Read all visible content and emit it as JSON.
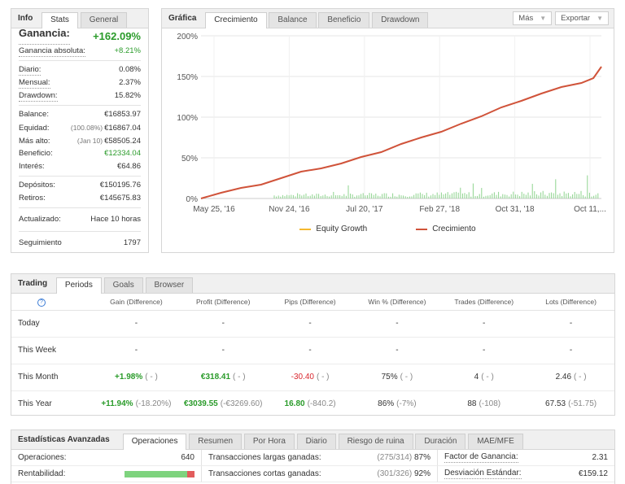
{
  "info": {
    "tabs": [
      "Info",
      "Stats",
      "General"
    ],
    "gain_label": "Ganancia:",
    "gain_value": "+162.09%",
    "abs_gain_label": "Ganancia absoluta:",
    "abs_gain_value": "+8.21%",
    "daily_label": "Diario:",
    "daily_value": "0.08%",
    "monthly_label": "Mensual:",
    "monthly_value": "2.37%",
    "drawdown_label": "Drawdown:",
    "drawdown_value": "15.82%",
    "balance_label": "Balance:",
    "balance_value": "€16853.97",
    "equity_label": "Equidad:",
    "equity_note": "(100.08%)",
    "equity_value": "€16867.04",
    "highest_label": "Más alto:",
    "highest_note": "(Jan 10)",
    "highest_value": "€58505.24",
    "profit_label": "Beneficio:",
    "profit_value": "€12334.04",
    "interest_label": "Interés:",
    "interest_value": "€64.86",
    "deposits_label": "Depósitos:",
    "deposits_value": "€150195.76",
    "withdrawals_label": "Retiros:",
    "withdrawals_value": "€145675.83",
    "updated_label": "Actualizado:",
    "updated_value": "Hace 10 horas",
    "following_label": "Seguimiento",
    "following_value": "1797"
  },
  "chart_panel": {
    "title": "Gráfica",
    "tabs": [
      "Crecimiento",
      "Balance",
      "Beneficio",
      "Drawdown"
    ],
    "more_label": "Más",
    "export_label": "Exportar",
    "legend": [
      "Equity Growth",
      "Crecimiento"
    ]
  },
  "chart_data": {
    "type": "line",
    "y_ticks": [
      "200%",
      "150%",
      "100%",
      "50%",
      "0%"
    ],
    "ylim": [
      0,
      200
    ],
    "x_ticks": [
      "May 25, '16",
      "Nov 24, '16",
      "Jul 20, '17",
      "Feb 27, '18",
      "Oct 31, '18",
      "Oct 11,..."
    ],
    "grid": true,
    "legend_position": "bottom",
    "series": [
      {
        "name": "Crecimiento",
        "color": "#d0533a",
        "x_frac": [
          0,
          0.05,
          0.1,
          0.15,
          0.2,
          0.25,
          0.3,
          0.35,
          0.4,
          0.45,
          0.5,
          0.55,
          0.6,
          0.65,
          0.7,
          0.75,
          0.8,
          0.85,
          0.9,
          0.95,
          0.98,
          1
        ],
        "values": [
          0,
          7,
          13,
          17,
          25,
          33,
          37,
          43,
          51,
          57,
          67,
          75,
          82,
          92,
          101,
          112,
          120,
          129,
          137,
          142,
          148,
          162
        ]
      },
      {
        "name": "Equity Growth",
        "color": "#f5b82e",
        "x_frac": [
          0,
          0.05,
          0.1,
          0.15,
          0.2,
          0.25,
          0.3,
          0.35,
          0.4,
          0.45,
          0.5,
          0.55,
          0.6,
          0.65,
          0.7,
          0.75,
          0.8,
          0.85,
          0.9,
          0.95,
          0.98,
          1
        ],
        "values": [
          0,
          7,
          13,
          17,
          25,
          33,
          37,
          43,
          51,
          57,
          67,
          75,
          82,
          92,
          101,
          112,
          120,
          129,
          137,
          142,
          148,
          162
        ]
      }
    ],
    "volume_bars_color": "#8fd48f"
  },
  "trading": {
    "title": "Trading",
    "tabs": [
      "Periods",
      "Goals",
      "Browser"
    ],
    "columns": [
      "",
      "Gain (Difference)",
      "Profit (Difference)",
      "Pips (Difference)",
      "Win % (Difference)",
      "Trades (Difference)",
      "Lots (Difference)"
    ],
    "rows": [
      {
        "period": "Today",
        "gain": "-",
        "gain_diff": "",
        "profit": "-",
        "profit_diff": "",
        "pips": "-",
        "pips_diff": "",
        "win": "-",
        "win_diff": "",
        "trades": "-",
        "trades_diff": "",
        "lots": "-",
        "lots_diff": ""
      },
      {
        "period": "This Week",
        "gain": "-",
        "gain_diff": "",
        "profit": "-",
        "profit_diff": "",
        "pips": "-",
        "pips_diff": "",
        "win": "-",
        "win_diff": "",
        "trades": "-",
        "trades_diff": "",
        "lots": "-",
        "lots_diff": ""
      },
      {
        "period": "This Month",
        "gain": "+1.98%",
        "gain_diff": "( - )",
        "profit": "€318.41",
        "profit_diff": "( - )",
        "pips": "-30.40",
        "pips_diff": "( - )",
        "win": "75%",
        "win_diff": "( - )",
        "trades": "4",
        "trades_diff": "( - )",
        "lots": "2.46",
        "lots_diff": "( - )"
      },
      {
        "period": "This Year",
        "gain": "+11.94%",
        "gain_diff": "(-18.20%)",
        "profit": "€3039.55",
        "profit_diff": "(-€3269.60)",
        "pips": "16.80",
        "pips_diff": "(-840.2)",
        "win": "86%",
        "win_diff": "(-7%)",
        "trades": "88",
        "trades_diff": "(-108)",
        "lots": "67.53",
        "lots_diff": "(-51.75)"
      }
    ]
  },
  "advanced": {
    "title": "Estadísticas Avanzadas",
    "tabs": [
      "Operaciones",
      "Resumen",
      "Por Hora",
      "Diario",
      "Riesgo de ruina",
      "Duración",
      "MAE/MFE"
    ],
    "ops_label": "Operaciones:",
    "ops_value": "640",
    "rent_label": "Rentabilidad:",
    "rent_fraction": 0.89,
    "long_label": "Transacciones largas ganadas:",
    "long_note": "(275/314)",
    "long_value": "87%",
    "short_label": "Transacciones cortas ganadas:",
    "short_note": "(301/326)",
    "short_value": "92%",
    "pf_label": "Factor de Ganancia:",
    "pf_value": "2.31",
    "sd_label": "Desviación Estándar:",
    "sd_value": "€159.12"
  }
}
